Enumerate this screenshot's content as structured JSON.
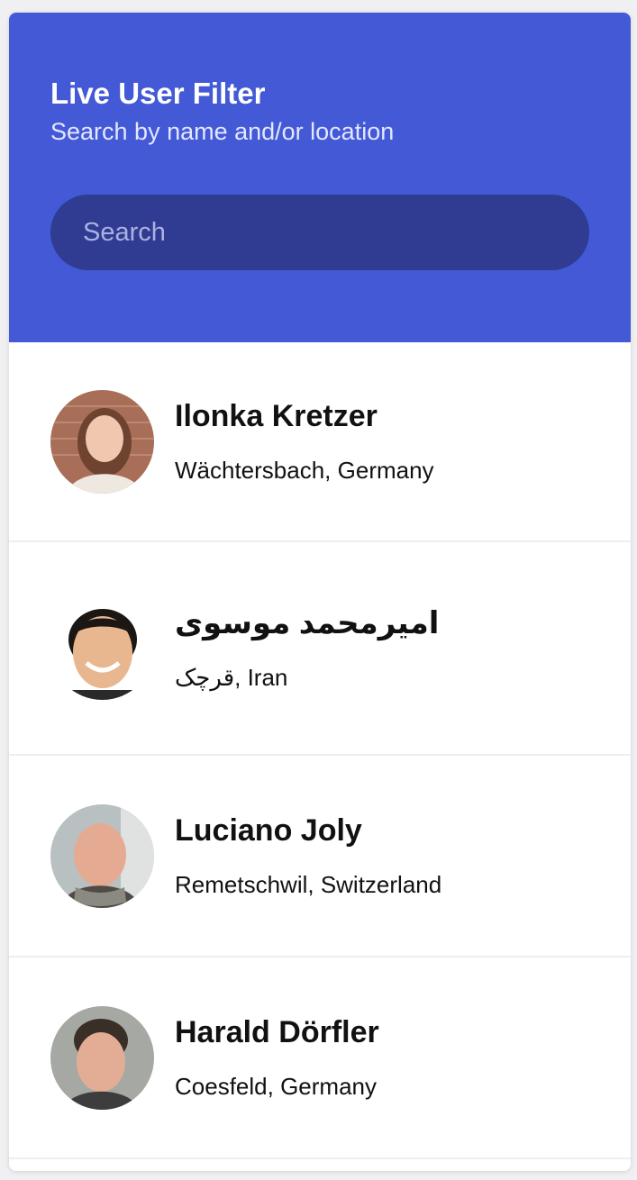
{
  "header": {
    "title": "Live User Filter",
    "subtitle": "Search by name and/or location",
    "search_placeholder": "Search"
  },
  "users": [
    {
      "name": "Ilonka Kretzer",
      "location": "Wächtersbach, Germany"
    },
    {
      "name": "امیرمحمد موسوی",
      "location": "قرچک, Iran"
    },
    {
      "name": "Luciano Joly",
      "location": "Remetschwil, Switzerland"
    },
    {
      "name": "Harald Dörfler",
      "location": "Coesfeld, Germany"
    }
  ],
  "colors": {
    "header_bg": "#4459d6",
    "search_bg": "#2f3c92"
  }
}
